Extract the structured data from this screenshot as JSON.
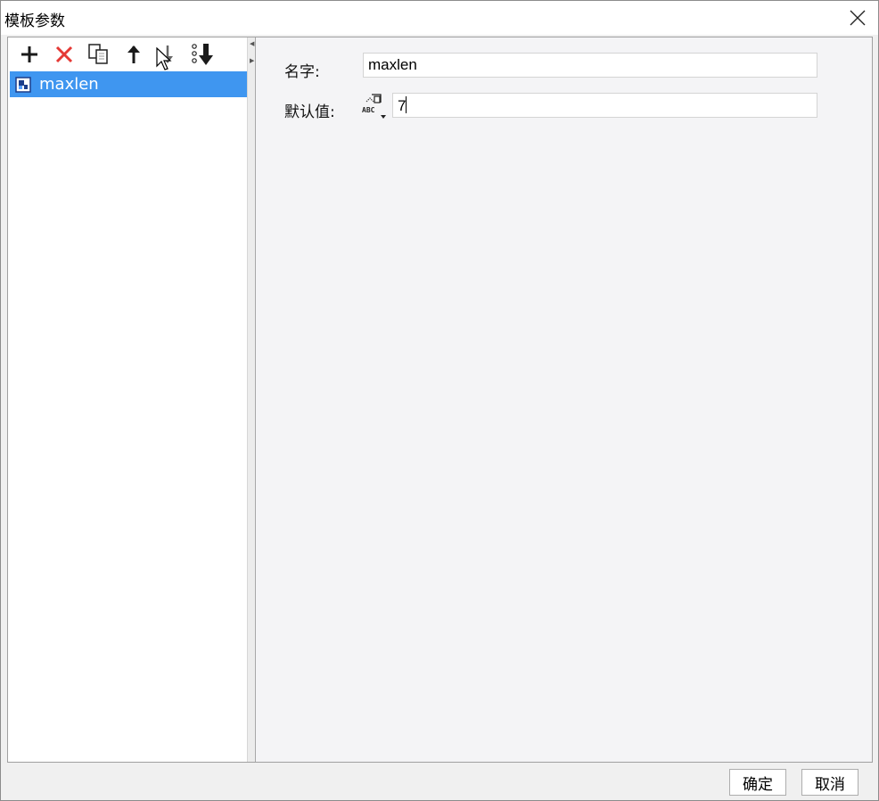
{
  "window": {
    "title": "模板参数",
    "close_icon": "close-icon"
  },
  "toolbar": {
    "buttons": [
      {
        "name": "add-icon"
      },
      {
        "name": "delete-icon",
        "color": "#e53935"
      },
      {
        "name": "copy-icon"
      },
      {
        "name": "move-up-icon"
      },
      {
        "name": "move-down-icon"
      },
      {
        "name": "move-to-bottom-icon"
      }
    ]
  },
  "params": {
    "items": [
      {
        "label": "maxlen",
        "selected": true
      }
    ],
    "selection_color": "#3f96f0"
  },
  "form": {
    "name_label": "名字:",
    "name_value": "maxlen",
    "default_label": "默认值:",
    "default_type_icon": "text-type-icon",
    "default_value": "7"
  },
  "footer": {
    "ok_label": "确定",
    "cancel_label": "取消"
  }
}
